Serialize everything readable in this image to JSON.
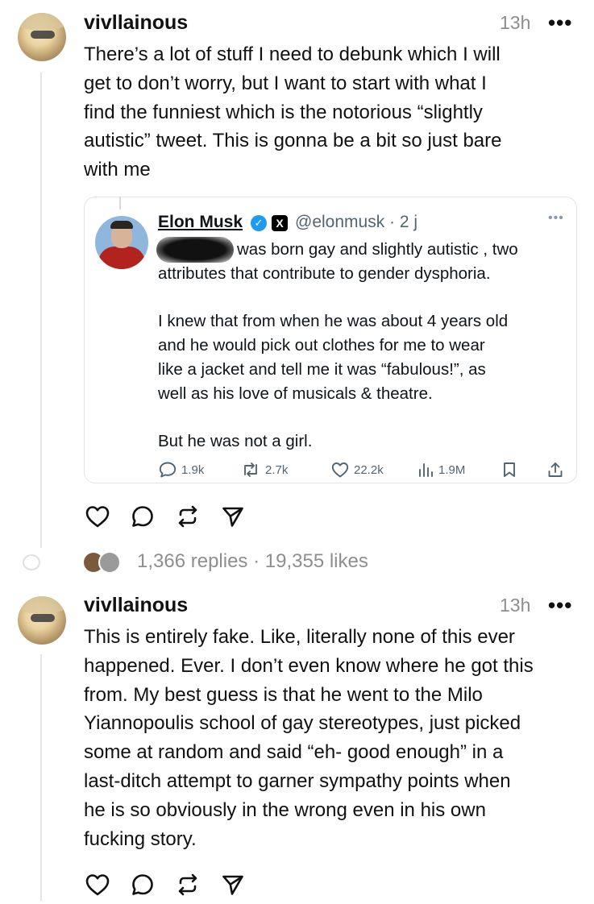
{
  "post1": {
    "username": "vivllainous",
    "time": "13h",
    "more": "•••",
    "text": "There’s a lot of stuff I need to debunk which I will\nget to don’t worry, but I want to start with what I\nfind the funniest which is the notorious “slightly\nautistic” tweet. This is gonna be a bit so just bare\nwith me"
  },
  "quoted_tweet": {
    "name": "Elon Musk",
    "x_badge": "X",
    "handle": "@elonmusk · 2 j",
    "more": "•••",
    "text": "was born gay and slightly autistic , two\nattributes that contribute to gender dysphoria.\n\nI knew that from when he was about 4 years old\nand he would pick out clothes for me to wear\nlike a jacket and tell me it was “fabulous!”, as\nwell as his love of musicals & theatre.\n\nBut he was not a girl.",
    "metrics": {
      "replies": "1.9k",
      "reposts": "2.7k",
      "likes": "22.2k",
      "views": "1.9M"
    }
  },
  "post1_stats": "1,366 replies · 19,355 likes",
  "post2": {
    "username": "vivllainous",
    "time": "13h",
    "more": "•••",
    "text": "This is entirely fake. Like, literally none of this ever\nhappened. Ever. I don’t even know where he got this\nfrom. My best guess is that he went to the Milo\nYiannopoulis school of gay stereotypes, just picked\nsome at random and said “eh- good enough” in a\nlast-ditch attempt to garner sympathy points when\nhe is so obviously in the wrong even in his own\nfucking story."
  },
  "icons": {
    "like": "heart-icon",
    "comment": "comment-icon",
    "repost": "repost-icon",
    "share": "send-icon",
    "bookmark": "bookmark-icon",
    "upload": "upload-icon",
    "views": "views-icon"
  },
  "colors": {
    "text": "#111111",
    "muted": "#8e8e8e",
    "verified": "#1d9bf0",
    "tweet_muted": "#536471"
  }
}
